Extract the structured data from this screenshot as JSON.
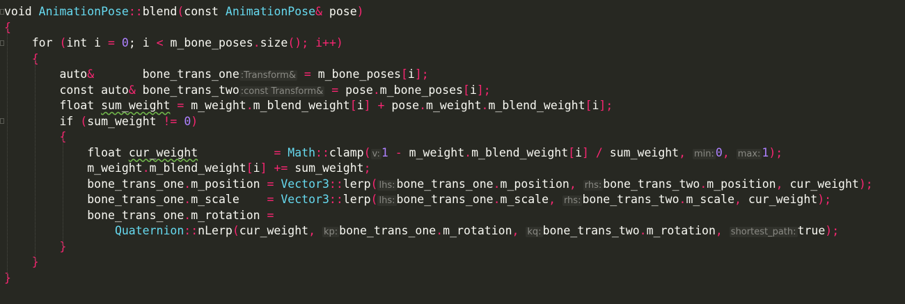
{
  "colors": {
    "background": "#272822",
    "text": "#f8f8f2",
    "keyword_type": "#66d9ef",
    "operator": "#f92672",
    "number": "#ae81ff",
    "inlay_hint": "#8a8a84",
    "warning_squiggle": "#6fb34a"
  },
  "code_lines": [
    {
      "tokens": [
        {
          "t": "void ",
          "c": "kw"
        },
        {
          "t": "AnimationPose",
          "c": "type"
        },
        {
          "t": "::",
          "c": "op"
        },
        {
          "t": "blend",
          "c": "kw"
        },
        {
          "t": "(",
          "c": "op"
        },
        {
          "t": "const ",
          "c": "kw"
        },
        {
          "t": "AnimationPose",
          "c": "type"
        },
        {
          "t": "& ",
          "c": "op"
        },
        {
          "t": "pose",
          "c": "kw"
        },
        {
          "t": ")",
          "c": "op"
        }
      ]
    },
    {
      "tokens": [
        {
          "t": "{",
          "c": "op"
        }
      ]
    },
    {
      "tokens": [
        {
          "t": "    for ",
          "c": "kw"
        },
        {
          "t": "(",
          "c": "op"
        },
        {
          "t": "int ",
          "c": "kw"
        },
        {
          "t": "i ",
          "c": "kw"
        },
        {
          "t": "= ",
          "c": "op"
        },
        {
          "t": "0",
          "c": "num"
        },
        {
          "t": "; i ",
          "c": "kw"
        },
        {
          "t": "<",
          "c": "op"
        },
        {
          "t": " m_bone_poses",
          "c": "kw"
        },
        {
          "t": ".",
          "c": "op"
        },
        {
          "t": "size",
          "c": "kw"
        },
        {
          "t": "(); i",
          "c": "op"
        },
        {
          "t": "++",
          "c": "op"
        },
        {
          "t": ")",
          "c": "op"
        }
      ]
    },
    {
      "tokens": [
        {
          "t": "    {",
          "c": "op"
        }
      ]
    },
    {
      "tokens": [
        {
          "t": "        auto",
          "c": "kw"
        },
        {
          "t": "&",
          "c": "op"
        },
        {
          "t": "       bone_trans_one",
          "c": "kw"
        },
        {
          "t": ":Transform&",
          "c": "hint"
        },
        {
          "t": " ",
          "c": "kw"
        },
        {
          "t": "=",
          "c": "op"
        },
        {
          "t": " m_bone_poses",
          "c": "kw"
        },
        {
          "t": "[",
          "c": "op"
        },
        {
          "t": "i",
          "c": "kw"
        },
        {
          "t": "];",
          "c": "op"
        }
      ]
    },
    {
      "tokens": [
        {
          "t": "        const auto",
          "c": "kw"
        },
        {
          "t": "&",
          "c": "op"
        },
        {
          "t": " bone_trans_two",
          "c": "kw"
        },
        {
          "t": ":const Transform&",
          "c": "hint"
        },
        {
          "t": " ",
          "c": "kw"
        },
        {
          "t": "=",
          "c": "op"
        },
        {
          "t": " pose",
          "c": "kw"
        },
        {
          "t": ".",
          "c": "op"
        },
        {
          "t": "m_bone_poses",
          "c": "kw"
        },
        {
          "t": "[",
          "c": "op"
        },
        {
          "t": "i",
          "c": "kw"
        },
        {
          "t": "];",
          "c": "op"
        }
      ]
    },
    {
      "tokens": [
        {
          "t": "        float ",
          "c": "kw"
        },
        {
          "t": "sum_weight",
          "c": "squig"
        },
        {
          "t": " ",
          "c": "kw"
        },
        {
          "t": "=",
          "c": "op"
        },
        {
          "t": " m_weight",
          "c": "kw"
        },
        {
          "t": ".",
          "c": "op"
        },
        {
          "t": "m_blend_weight",
          "c": "kw"
        },
        {
          "t": "[",
          "c": "op"
        },
        {
          "t": "i",
          "c": "kw"
        },
        {
          "t": "] + ",
          "c": "op"
        },
        {
          "t": "pose",
          "c": "kw"
        },
        {
          "t": ".",
          "c": "op"
        },
        {
          "t": "m_weight",
          "c": "kw"
        },
        {
          "t": ".",
          "c": "op"
        },
        {
          "t": "m_blend_weight",
          "c": "kw"
        },
        {
          "t": "[",
          "c": "op"
        },
        {
          "t": "i",
          "c": "kw"
        },
        {
          "t": "];",
          "c": "op"
        }
      ]
    },
    {
      "tokens": [
        {
          "t": "        if ",
          "c": "kw"
        },
        {
          "t": "(",
          "c": "op"
        },
        {
          "t": "sum_weight ",
          "c": "kw"
        },
        {
          "t": "!=",
          "c": "op"
        },
        {
          "t": " ",
          "c": "kw"
        },
        {
          "t": "0",
          "c": "num"
        },
        {
          "t": ")",
          "c": "op"
        }
      ]
    },
    {
      "tokens": [
        {
          "t": "        {",
          "c": "op"
        }
      ]
    },
    {
      "tokens": [
        {
          "t": "            float ",
          "c": "kw"
        },
        {
          "t": "cur_weight",
          "c": "squig"
        },
        {
          "t": "           ",
          "c": "kw"
        },
        {
          "t": "=",
          "c": "op"
        },
        {
          "t": " Math",
          "c": "type"
        },
        {
          "t": "::",
          "c": "op"
        },
        {
          "t": "clamp",
          "c": "kw"
        },
        {
          "t": "(",
          "c": "op"
        },
        {
          "t": "v:",
          "c": "hint"
        },
        {
          "t": "1",
          "c": "num"
        },
        {
          "t": " - ",
          "c": "op"
        },
        {
          "t": "m_weight",
          "c": "kw"
        },
        {
          "t": ".",
          "c": "op"
        },
        {
          "t": "m_blend_weight",
          "c": "kw"
        },
        {
          "t": "[",
          "c": "op"
        },
        {
          "t": "i",
          "c": "kw"
        },
        {
          "t": "] / ",
          "c": "op"
        },
        {
          "t": "sum_weight",
          "c": "kw"
        },
        {
          "t": ", ",
          "c": "op"
        },
        {
          "t": "min:",
          "c": "hint"
        },
        {
          "t": "0",
          "c": "num"
        },
        {
          "t": ", ",
          "c": "op"
        },
        {
          "t": "max:",
          "c": "hint"
        },
        {
          "t": "1",
          "c": "num"
        },
        {
          "t": ");",
          "c": "op"
        }
      ]
    },
    {
      "tokens": [
        {
          "t": "            m_weight",
          "c": "kw"
        },
        {
          "t": ".",
          "c": "op"
        },
        {
          "t": "m_blend_weight",
          "c": "kw"
        },
        {
          "t": "[",
          "c": "op"
        },
        {
          "t": "i",
          "c": "kw"
        },
        {
          "t": "] += ",
          "c": "op"
        },
        {
          "t": "sum_weight",
          "c": "kw"
        },
        {
          "t": ";",
          "c": "op"
        }
      ]
    },
    {
      "tokens": [
        {
          "t": "            bone_trans_one",
          "c": "kw"
        },
        {
          "t": ".",
          "c": "op"
        },
        {
          "t": "m_position ",
          "c": "kw"
        },
        {
          "t": "=",
          "c": "op"
        },
        {
          "t": " Vector3",
          "c": "type"
        },
        {
          "t": "::",
          "c": "op"
        },
        {
          "t": "lerp",
          "c": "kw"
        },
        {
          "t": "(",
          "c": "op"
        },
        {
          "t": "lhs:",
          "c": "hint"
        },
        {
          "t": "bone_trans_one",
          "c": "kw"
        },
        {
          "t": ".",
          "c": "op"
        },
        {
          "t": "m_position",
          "c": "kw"
        },
        {
          "t": ", ",
          "c": "op"
        },
        {
          "t": "rhs:",
          "c": "hint"
        },
        {
          "t": "bone_trans_two",
          "c": "kw"
        },
        {
          "t": ".",
          "c": "op"
        },
        {
          "t": "m_position",
          "c": "kw"
        },
        {
          "t": ", ",
          "c": "op"
        },
        {
          "t": "cur_weight",
          "c": "kw"
        },
        {
          "t": ");",
          "c": "op"
        }
      ]
    },
    {
      "tokens": [
        {
          "t": "            bone_trans_one",
          "c": "kw"
        },
        {
          "t": ".",
          "c": "op"
        },
        {
          "t": "m_scale    ",
          "c": "kw"
        },
        {
          "t": "=",
          "c": "op"
        },
        {
          "t": " Vector3",
          "c": "type"
        },
        {
          "t": "::",
          "c": "op"
        },
        {
          "t": "lerp",
          "c": "kw"
        },
        {
          "t": "(",
          "c": "op"
        },
        {
          "t": "lhs:",
          "c": "hint"
        },
        {
          "t": "bone_trans_one",
          "c": "kw"
        },
        {
          "t": ".",
          "c": "op"
        },
        {
          "t": "m_scale",
          "c": "kw"
        },
        {
          "t": ", ",
          "c": "op"
        },
        {
          "t": "rhs:",
          "c": "hint"
        },
        {
          "t": "bone_trans_two",
          "c": "kw"
        },
        {
          "t": ".",
          "c": "op"
        },
        {
          "t": "m_scale",
          "c": "kw"
        },
        {
          "t": ", ",
          "c": "op"
        },
        {
          "t": "cur_weight",
          "c": "kw"
        },
        {
          "t": ");",
          "c": "op"
        }
      ]
    },
    {
      "tokens": [
        {
          "t": "            bone_trans_one",
          "c": "kw"
        },
        {
          "t": ".",
          "c": "op"
        },
        {
          "t": "m_rotation ",
          "c": "kw"
        },
        {
          "t": "=",
          "c": "op"
        }
      ]
    },
    {
      "tokens": [
        {
          "t": "                Quaternion",
          "c": "type"
        },
        {
          "t": "::",
          "c": "op"
        },
        {
          "t": "nLerp",
          "c": "kw"
        },
        {
          "t": "(",
          "c": "op"
        },
        {
          "t": "cur_weight",
          "c": "kw"
        },
        {
          "t": ", ",
          "c": "op"
        },
        {
          "t": "kp:",
          "c": "hint"
        },
        {
          "t": "bone_trans_one",
          "c": "kw"
        },
        {
          "t": ".",
          "c": "op"
        },
        {
          "t": "m_rotation",
          "c": "kw"
        },
        {
          "t": ", ",
          "c": "op"
        },
        {
          "t": "kq:",
          "c": "hint"
        },
        {
          "t": "bone_trans_two",
          "c": "kw"
        },
        {
          "t": ".",
          "c": "op"
        },
        {
          "t": "m_rotation",
          "c": "kw"
        },
        {
          "t": ", ",
          "c": "op"
        },
        {
          "t": "shortest_path:",
          "c": "hint"
        },
        {
          "t": "true",
          "c": "kw"
        },
        {
          "t": ");",
          "c": "op"
        }
      ]
    },
    {
      "tokens": [
        {
          "t": "        }",
          "c": "op"
        }
      ]
    },
    {
      "tokens": [
        {
          "t": "    }",
          "c": "op"
        }
      ]
    },
    {
      "tokens": [
        {
          "t": "}",
          "c": "op"
        }
      ]
    }
  ]
}
